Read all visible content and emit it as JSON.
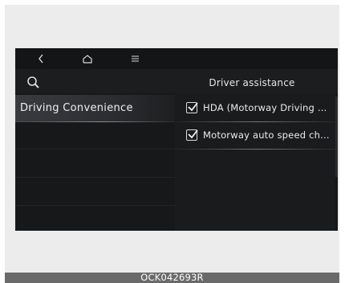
{
  "nav": {
    "back_icon": "chevron-left-icon",
    "home_icon": "home-icon",
    "menu_icon": "menu-icon"
  },
  "header": {
    "search_icon": "search-icon",
    "title": "Driver assistance"
  },
  "left_menu": {
    "items": [
      {
        "label": "Driving Convenience",
        "selected": true
      }
    ]
  },
  "options": [
    {
      "label": "HDA (Motorway Driving ...",
      "checked": true
    },
    {
      "label": "Motorway auto speed ch...",
      "checked": true
    }
  ],
  "caption": "OCK042693R"
}
